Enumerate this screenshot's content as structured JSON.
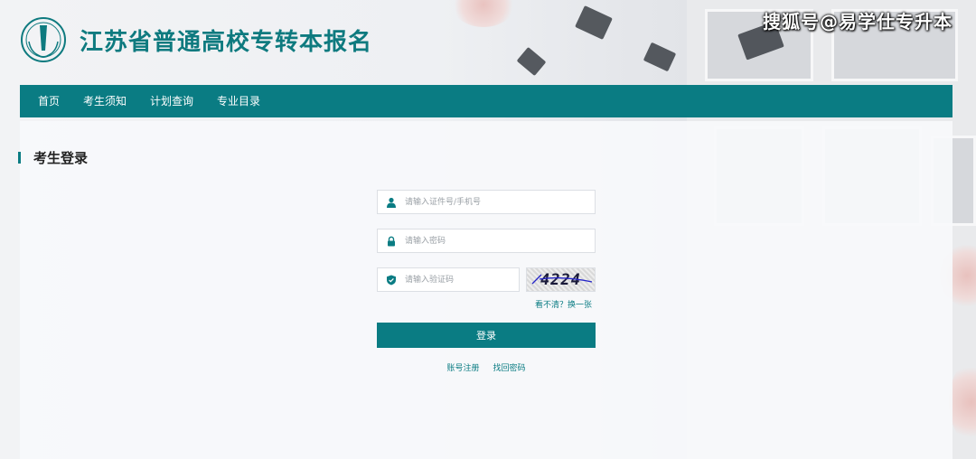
{
  "header": {
    "site_title": "江苏省普通高校专转本报名"
  },
  "watermark": "搜狐号@易学仕专升本",
  "nav": {
    "items": [
      {
        "label": "首页"
      },
      {
        "label": "考生须知"
      },
      {
        "label": "计划查询"
      },
      {
        "label": "专业目录"
      }
    ]
  },
  "login": {
    "section_title": "考生登录",
    "id_placeholder": "请输入证件号/手机号",
    "password_placeholder": "请输入密码",
    "captcha_placeholder": "请输入验证码",
    "captcha_code": "4224",
    "refresh_label": "看不清？换一张",
    "submit_label": "登录",
    "register_link": "账号注册",
    "recover_link": "找回密码"
  },
  "colors": {
    "accent": "#0a7c83",
    "title": "#0e7a7f"
  },
  "icons": {
    "logo": "school-emblem-icon",
    "user": "user-icon",
    "password": "lock-icon",
    "captcha": "shield-check-icon"
  }
}
